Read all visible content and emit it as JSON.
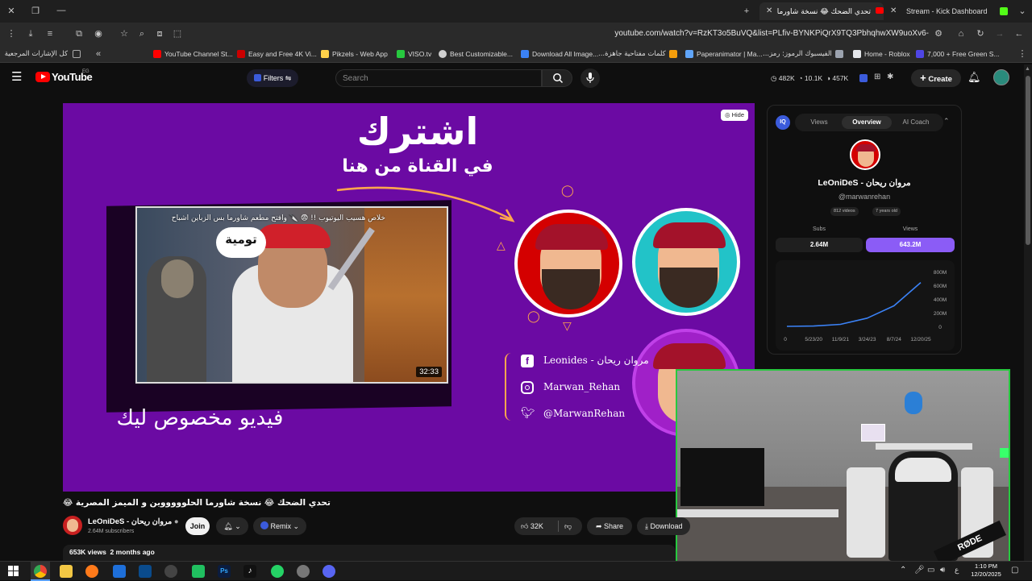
{
  "browser": {
    "tabs": [
      {
        "label": "تحدي الضحك 😂 نسخة شاورما",
        "color": "#ff0000",
        "active": true
      },
      {
        "label": "Stream - Kick Dashboard",
        "color": "#53fc18",
        "active": false
      }
    ],
    "url": "youtube.com/watch?v=RzKT3o5BuVQ&list=PLfiv-BYNKPiQrX9TQ3PbhqhwXW9uoXv6-",
    "bookmarks": [
      {
        "label": "كل الإشارات المرجعية",
        "color": "#888888"
      },
      {
        "label": "YouTube Channel St...",
        "color": "#ff0000"
      },
      {
        "label": "Easy and Free 4K Vi...",
        "color": "#cc0000"
      },
      {
        "label": "Pikzels - Web App",
        "color": "#ffd24a"
      },
      {
        "label": "VISO.tv",
        "color": "#27c93f"
      },
      {
        "label": "Best Customizable...",
        "color": "#cfcfcf"
      },
      {
        "label": "Download All Image...",
        "color": "#3b82f6"
      },
      {
        "label": "كلمات مفتاحية جاهزة...",
        "color": "#f59e0b"
      },
      {
        "label": "Paperanimator | Ma...",
        "color": "#60a5fa"
      },
      {
        "label": "الفيسبوك الرموز: رمز...",
        "color": "#9ca3af"
      },
      {
        "label": "Home - Roblox",
        "color": "#e5e7eb"
      },
      {
        "label": "7,000 + Free Green S...",
        "color": "#4f46e5"
      }
    ]
  },
  "youtube": {
    "logo": "YouTube",
    "logo_region": "EG",
    "filters_label": "Filters",
    "search_placeholder": "Search",
    "stats": {
      "a": "482K",
      "b": "10.1K",
      "c": "457K"
    },
    "create_label": "Create"
  },
  "video": {
    "hide_label": "Hide",
    "headline": "اشترك",
    "subheadline": "في القناة من هنا",
    "thumb_title": "خلاص هسيب اليوتيوب !! 😨 🔪 وافتح مطعم شاورما بس الزباين اشباح",
    "thumb_bubble": "تومية",
    "thumb_duration": "32:33",
    "bottom_text": "فيديو مخصوص ليك",
    "socials": [
      {
        "icon": "facebook-icon",
        "text": "Leonides - مروان ريحان"
      },
      {
        "icon": "instagram-icon",
        "text": "Marwan_Rehan"
      },
      {
        "icon": "twitter-icon",
        "text": "@MarwanRehan"
      }
    ]
  },
  "panel": {
    "tabs": [
      "Views",
      "Overview",
      "AI Coach"
    ],
    "channel_name": "LeOniDeS - مروان ريحان",
    "handle": "@marwanrehan",
    "videos": "812 videos",
    "age": "7 years old",
    "subs_label": "Subs",
    "subs_value": "2.64M",
    "views_label": "Views",
    "views_value": "643.2M",
    "chart_yticks": [
      "800M",
      "600M",
      "400M",
      "200M",
      "0"
    ],
    "chart_xticks": [
      "0",
      "5/23/20",
      "11/9/21",
      "3/24/23",
      "8/7/24",
      "12/20/25"
    ]
  },
  "chart_data": {
    "type": "line",
    "x": [
      "0",
      "5/23/20",
      "11/9/21",
      "3/24/23",
      "8/7/24",
      "12/20/25"
    ],
    "series": [
      {
        "values": [
          0,
          5,
          30,
          120,
          300,
          640
        ]
      }
    ],
    "ylim": [
      0,
      800
    ],
    "grid": false
  },
  "meta": {
    "title": "تحدي الضحك 😂 نسخة شاورما الحلوووووين و الميمز المصرية 😂",
    "channel": "LeOniDeS - مروان ريحان",
    "subscribers": "2.64M subscribers",
    "join_label": "Join",
    "remix_label": "Remix",
    "likes": "32K",
    "share_label": "Share",
    "download_label": "Download",
    "views_date": "653K views  2 months ago"
  },
  "taskbar": {
    "clock_time": "1:10 PM",
    "clock_date": "12/20/2025"
  }
}
